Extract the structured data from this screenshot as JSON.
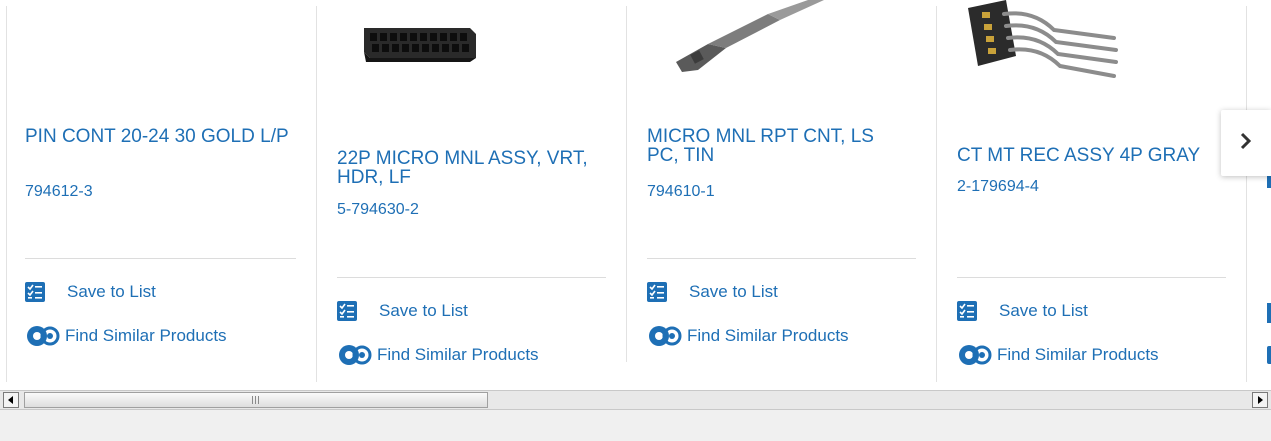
{
  "colors": {
    "link": "#1e6fb5",
    "divider": "#e2e2e2"
  },
  "products": [
    {
      "title": "PIN CONT 20-24 30 GOLD L/P",
      "part_number": "794612-3",
      "save_label": "Save to List",
      "similar_label": "Find Similar Products"
    },
    {
      "title": "22P MICRO MNL ASSY, VRT, HDR, LF",
      "part_number": "5-794630-2",
      "save_label": "Save to List",
      "similar_label": "Find Similar Products"
    },
    {
      "title": "MICRO MNL RPT CNT, LS PC, TIN",
      "part_number": "794610-1",
      "save_label": "Save to List",
      "similar_label": "Find Similar Products"
    },
    {
      "title": "CT MT REC ASSY 4P GRAY",
      "part_number": "2-179694-4",
      "save_label": "Save to List",
      "similar_label": "Find Similar Products"
    }
  ],
  "icons": {
    "save": "checklist-icon",
    "similar": "gear-cluster-icon",
    "next": "chevron-right-icon",
    "scroll_left": "triangle-left-icon",
    "scroll_right": "triangle-right-icon"
  },
  "scrollbar": {
    "position": 0.05
  }
}
